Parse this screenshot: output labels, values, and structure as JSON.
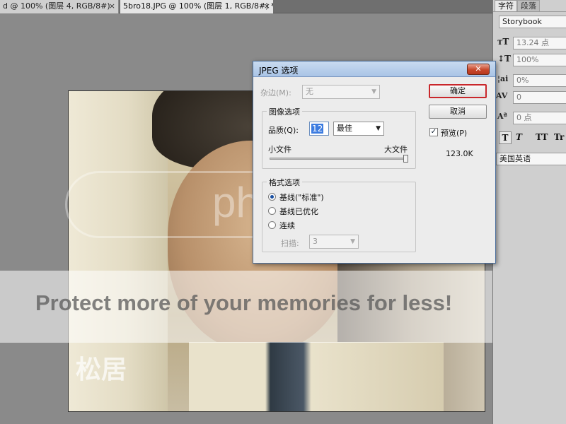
{
  "document_tabs": [
    {
      "label": "d @ 100% (图层 4, RGB/8#)",
      "close": "×"
    },
    {
      "label": "5bro18.JPG @ 100% (图层 1, RGB/8#) *",
      "close": "×"
    }
  ],
  "watermark": {
    "brand": "photobucket",
    "tagline": "Protect more of your memories for less!",
    "logo_text": "松居"
  },
  "panel": {
    "tabs": [
      "字符",
      "段落"
    ],
    "font_family": "Storybook",
    "font_size": "13.24 点",
    "vertical_scale": "100%",
    "tracking": "0%",
    "kerning": "0",
    "baseline_shift": "0 点",
    "style_buttons": [
      "T",
      "T",
      "TT",
      "Tr"
    ],
    "language": "美国英语"
  },
  "dialog": {
    "title": "JPEG 选项",
    "close": "✕",
    "matte_label": "杂边(M):",
    "matte_value": "无",
    "image_options": {
      "title": "图像选项",
      "quality_label": "品质(Q):",
      "quality_value": "12",
      "quality_preset": "最佳",
      "small_file": "小文件",
      "large_file": "大文件",
      "slider_fraction": 1.0
    },
    "format_options": {
      "title": "格式选项",
      "options": [
        "基线(\"标准\")",
        "基线已优化",
        "连续"
      ],
      "selected_index": 0,
      "scans_label": "扫描:",
      "scans_value": "3"
    },
    "ok_button": "确定",
    "cancel_button": "取消",
    "preview_label": "预览(P)",
    "preview_checked": true,
    "file_size": "123.0K"
  },
  "colors": {
    "dialog_title_bar": "#b8cfeb",
    "close_button": "#c8472b",
    "default_button_border": "#c9272b"
  }
}
